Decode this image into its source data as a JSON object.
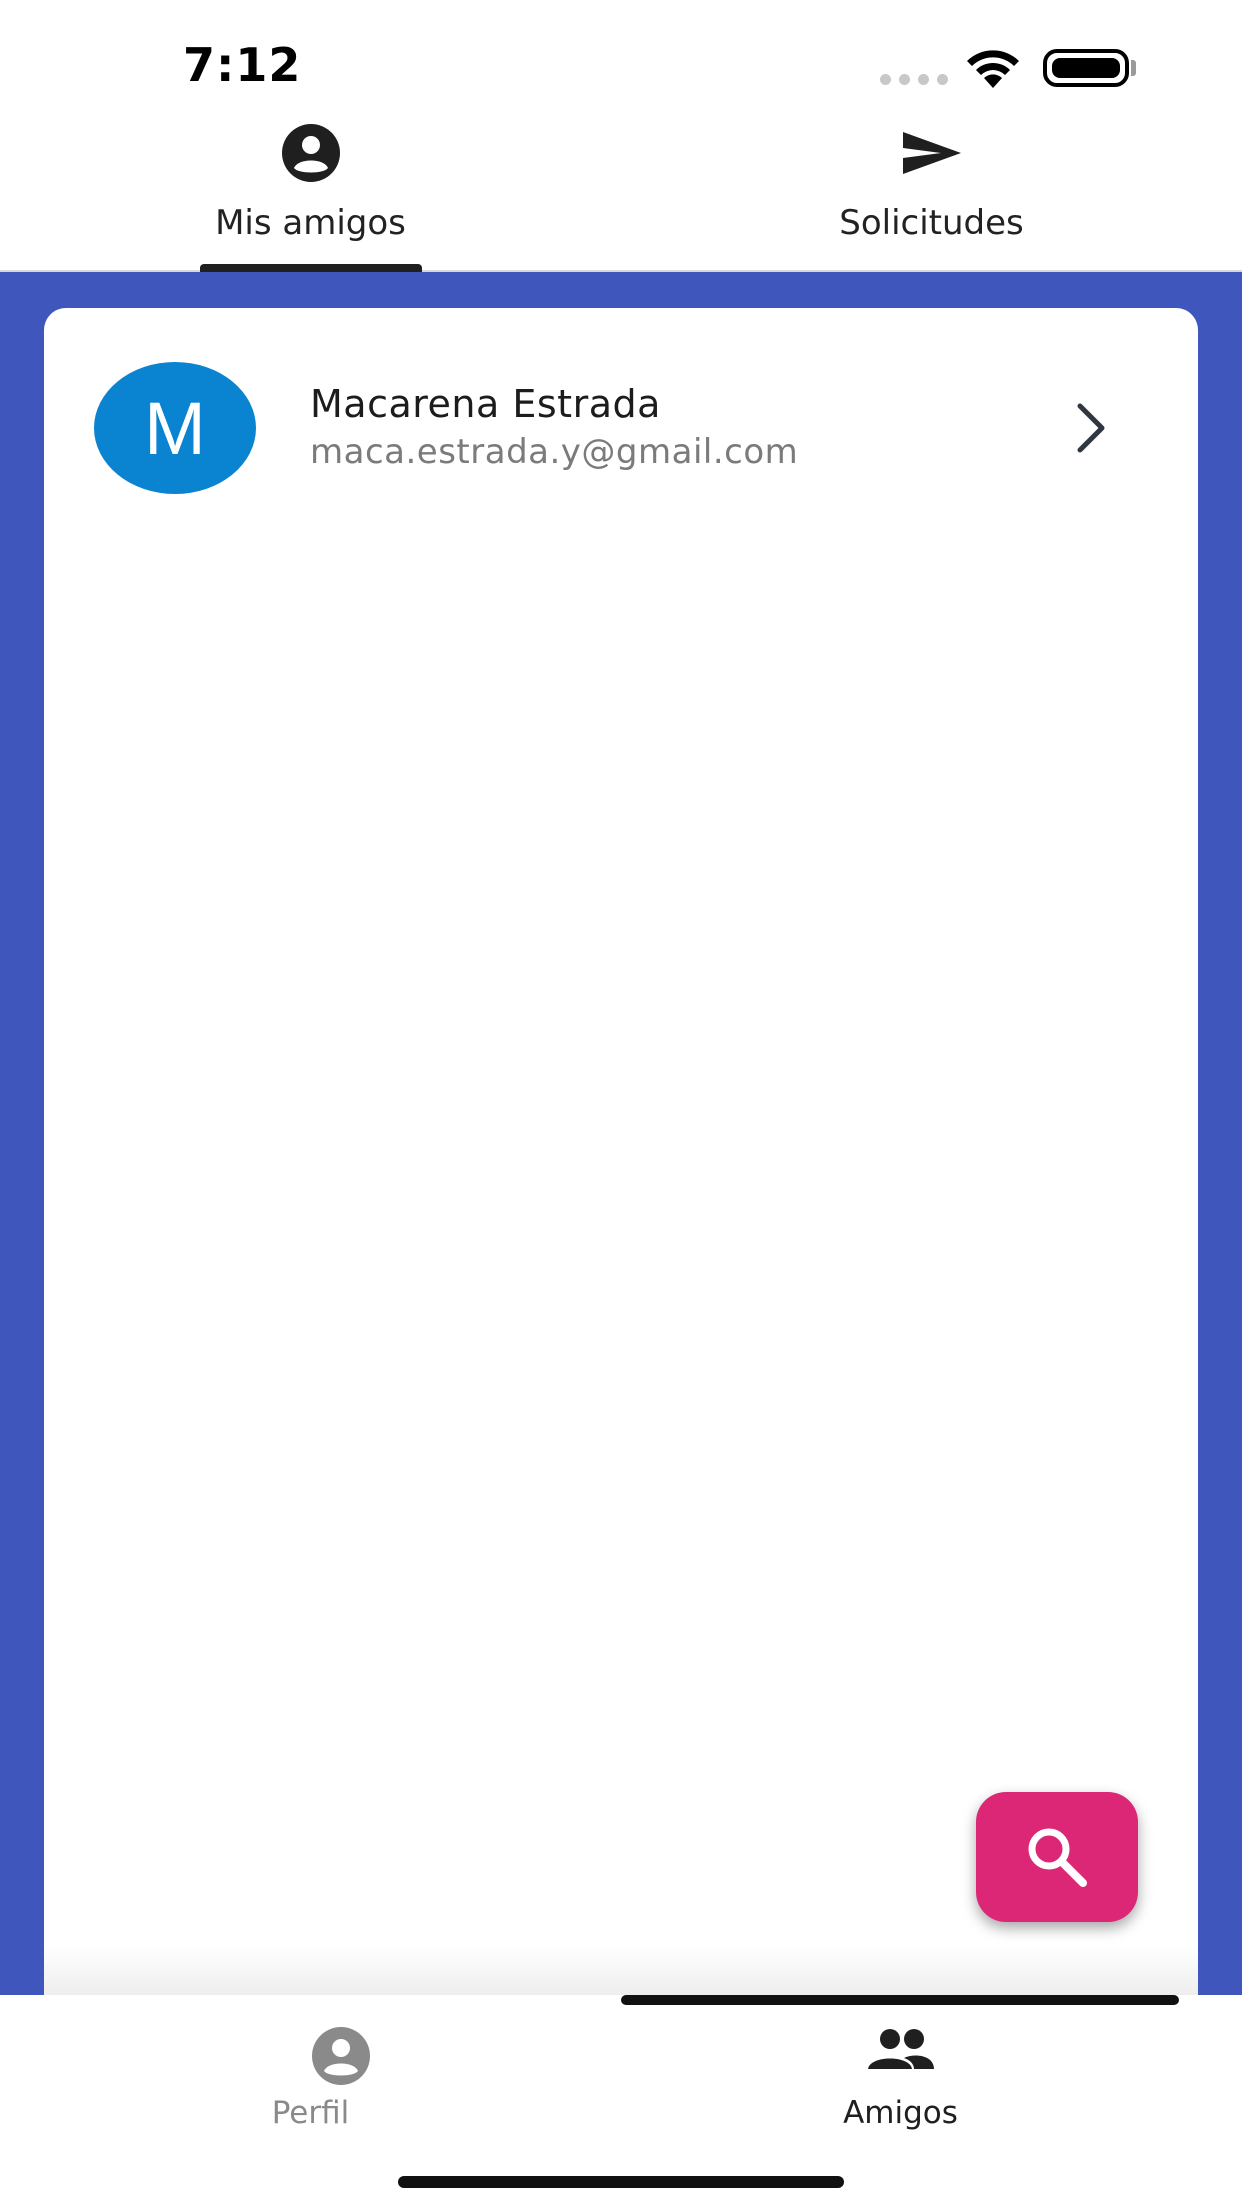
{
  "status_bar": {
    "time": "7:12"
  },
  "top_tabs": [
    {
      "label": "Mis amigos",
      "icon": "account-circle-icon",
      "selected": true
    },
    {
      "label": "Solicitudes",
      "icon": "send-icon",
      "selected": false
    }
  ],
  "friends": [
    {
      "initial": "M",
      "name": "Macarena Estrada",
      "email": "maca.estrada.y@gmail.com"
    }
  ],
  "fab": {
    "icon": "search-icon"
  },
  "bottom_nav": [
    {
      "label": "Perfil",
      "icon": "account-circle-icon",
      "selected": false
    },
    {
      "label": "Amigos",
      "icon": "people-icon",
      "selected": true
    }
  ],
  "colors": {
    "background_blue": "#3f57bd",
    "avatar_blue": "#0a84d0",
    "fab_pink": "#dc2676",
    "inactive_gray": "#8a8a8a"
  }
}
